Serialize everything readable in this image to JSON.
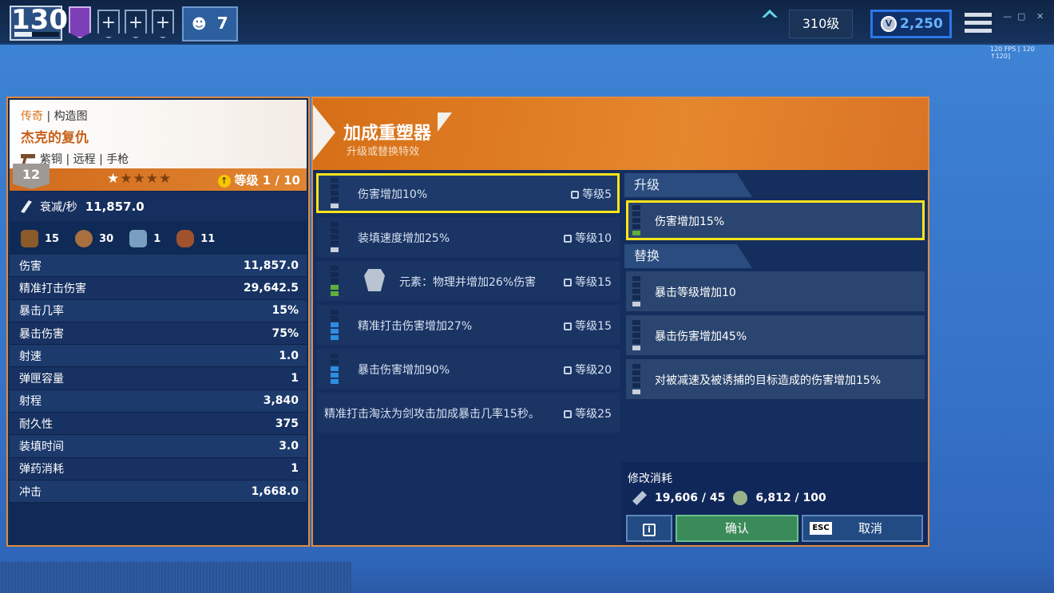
{
  "topbar": {
    "power_level": "130",
    "party_count": "7",
    "account_level": "310级",
    "vbucks": "2,250",
    "vbucks_icon": "V",
    "fps": "120 FPS [ 120 ↑120]",
    "win_min": "—",
    "win_max": "▢",
    "win_close": "✕",
    "plus": "+"
  },
  "weapon": {
    "rarity": "传奇",
    "category": "构造图",
    "name": "杰克的复仇",
    "tags": "紫铜 | 远程 | 手枪",
    "level_badge": "12",
    "stars_filled": 1,
    "stars_total": 5,
    "star_on": "★",
    "stars_off": "★★★★",
    "level_text": "等级 1 / 10",
    "up_icon": "↑",
    "dps_label": "衰减/秒",
    "dps_value": "11,857.0",
    "materials": [
      {
        "value": "15",
        "color": "#8b5a2b"
      },
      {
        "value": "30",
        "color": "#a87040"
      },
      {
        "value": "1",
        "color": "#7a9ec0"
      },
      {
        "value": "11",
        "color": "#a0522d"
      }
    ]
  },
  "stats": [
    {
      "label": "伤害",
      "value": "11,857.0"
    },
    {
      "label": "精准打击伤害",
      "value": "29,642.5"
    },
    {
      "label": "暴击几率",
      "value": "15%"
    },
    {
      "label": "暴击伤害",
      "value": "75%"
    },
    {
      "label": "射速",
      "value": "1.0"
    },
    {
      "label": "弹匣容量",
      "value": "1"
    },
    {
      "label": "射程",
      "value": "3,840"
    },
    {
      "label": "耐久性",
      "value": "375"
    },
    {
      "label": "装填时间",
      "value": "3.0"
    },
    {
      "label": "弹药消耗",
      "value": "1"
    },
    {
      "label": "冲击",
      "value": "1,668.0"
    }
  ],
  "reperk": {
    "title": "加成重塑器",
    "subtitle": "升级或替换特效",
    "perks": [
      {
        "name": "伤害增加10%",
        "req": "等级5"
      },
      {
        "name": "装填速度增加25%",
        "req": "等级10"
      },
      {
        "name": "元素：物理并增加26%伤害",
        "req": "等级15"
      },
      {
        "name": "精准打击伤害增加27%",
        "req": "等级15"
      },
      {
        "name": "暴击伤害增加90%",
        "req": "等级20"
      },
      {
        "name": "精准打击淘汰为剑攻击加成暴击几率15秒。",
        "req": "等级25"
      }
    ],
    "upgrade_header": "升级",
    "upgrade": {
      "name": "伤害增加15%"
    },
    "replace_header": "替换",
    "replacements": [
      {
        "name": "暴击等级增加10"
      },
      {
        "name": "暴击伤害增加45%"
      },
      {
        "name": "对被减速及被诱捕的目标造成的伤害增加15%"
      }
    ],
    "cost_label": "修改消耗",
    "cost1": "19,606 / 45",
    "cost2": "6,812 / 100",
    "confirm": "确认",
    "cancel": "取消",
    "esc": "ESC",
    "info": "i"
  }
}
